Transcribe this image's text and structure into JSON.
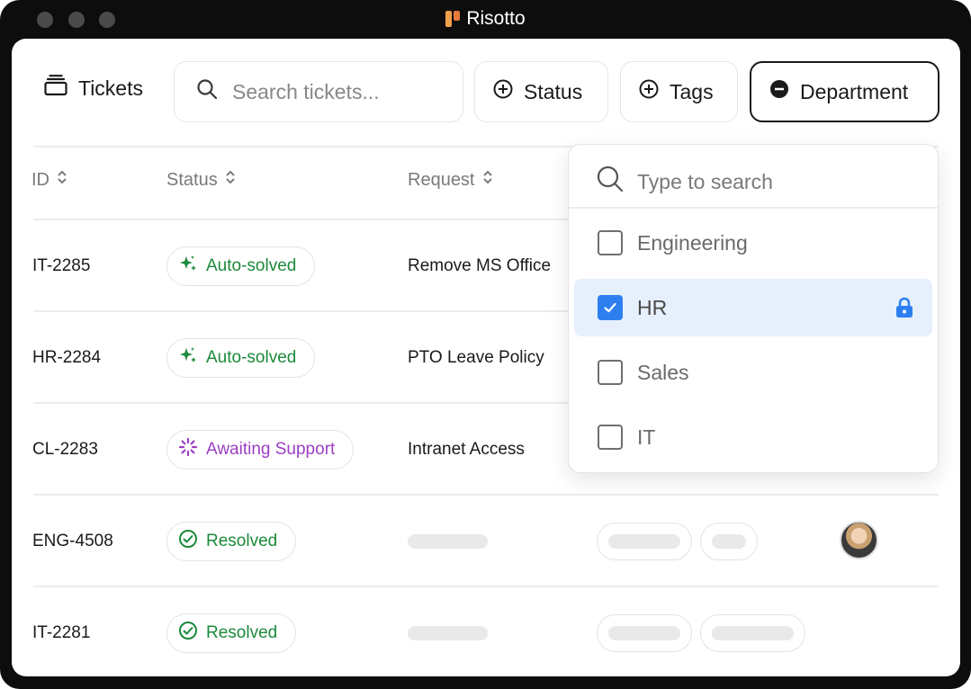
{
  "window": {
    "title": "Risotto"
  },
  "toolbar": {
    "tickets_label": "Tickets",
    "search_placeholder": "Search tickets...",
    "status_label": "Status",
    "tags_label": "Tags",
    "department_label": "Department"
  },
  "table": {
    "headers": {
      "id": "ID",
      "status": "Status",
      "request": "Request"
    },
    "rows": [
      {
        "id": "IT-2285",
        "status": "Auto-solved",
        "status_kind": "auto",
        "request": "Remove MS Office"
      },
      {
        "id": "HR-2284",
        "status": "Auto-solved",
        "status_kind": "auto",
        "request": "PTO Leave Policy"
      },
      {
        "id": "CL-2283",
        "status": "Awaiting Support",
        "status_kind": "awaiting",
        "request": "Intranet Access"
      },
      {
        "id": "ENG-4508",
        "status": "Resolved",
        "status_kind": "resolved",
        "request": ""
      },
      {
        "id": "IT-2281",
        "status": "Resolved",
        "status_kind": "resolved",
        "request": ""
      }
    ]
  },
  "department_dropdown": {
    "search_placeholder": "Type to search",
    "options": [
      {
        "label": "Engineering",
        "checked": false
      },
      {
        "label": "HR",
        "checked": true,
        "locked": true
      },
      {
        "label": "Sales",
        "checked": false
      },
      {
        "label": "IT",
        "checked": false
      }
    ]
  },
  "colors": {
    "green": "#1b8a3a",
    "purple": "#9b3fc4",
    "accent_blue": "#2d7ff0",
    "selected_bg": "#e6f0fc"
  }
}
